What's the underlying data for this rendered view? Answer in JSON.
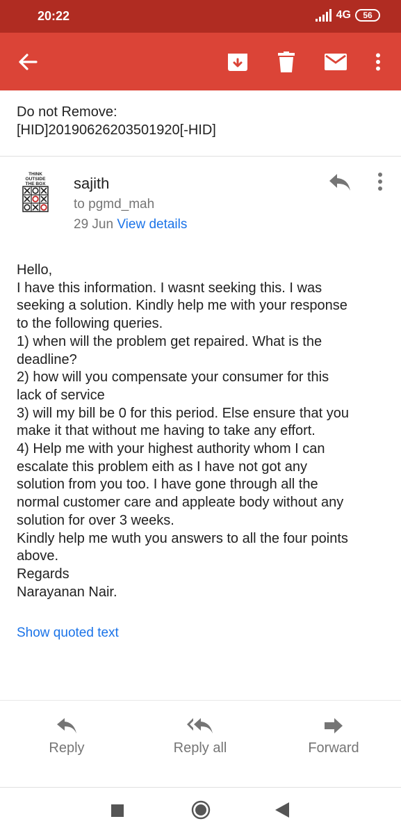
{
  "status_bar": {
    "time": "20:22",
    "network": "4G",
    "battery": "56"
  },
  "app_bar": {
    "icons": [
      "back-arrow-icon",
      "archive-icon",
      "delete-icon",
      "mail-icon",
      "more-vert-icon"
    ],
    "background": "#db4437"
  },
  "subject": {
    "line1": "Do not Remove:",
    "line2": "[HID]20190626203501920[-HID]"
  },
  "sender": {
    "name": "sajith",
    "to": "to pgmd_mah",
    "date": "29 Jun",
    "view_details": "View details",
    "avatar_text": "THINK OUTSIDE THE BOX"
  },
  "body": {
    "lines": [
      "Hello,",
      "I have this information. I wasnt seeking this. I was",
      "seeking a solution. Kindly help me with your response",
      "to the following queries.",
      "1) when will the problem get repaired. What is the",
      "deadline?",
      "2) how will you compensate your consumer for this",
      "lack of service",
      "3) will my bill be 0 for this period. Else ensure that you",
      "make it that without me having to take any effort.",
      "4) Help me with your highest authority whom I can",
      "escalate this problem eith as I have not got any",
      "solution from you too. I have gone through all the",
      "normal customer care and appleate body without any",
      "solution for over 3 weeks.",
      "Kindly help me wuth you answers to all the four points",
      "above.",
      "Regards",
      "Narayanan Nair."
    ]
  },
  "show_quoted": "Show quoted text",
  "actions": {
    "reply": "Reply",
    "reply_all": "Reply all",
    "forward": "Forward"
  },
  "colors": {
    "status_bar": "#b02c22",
    "link": "#1a73e8"
  }
}
